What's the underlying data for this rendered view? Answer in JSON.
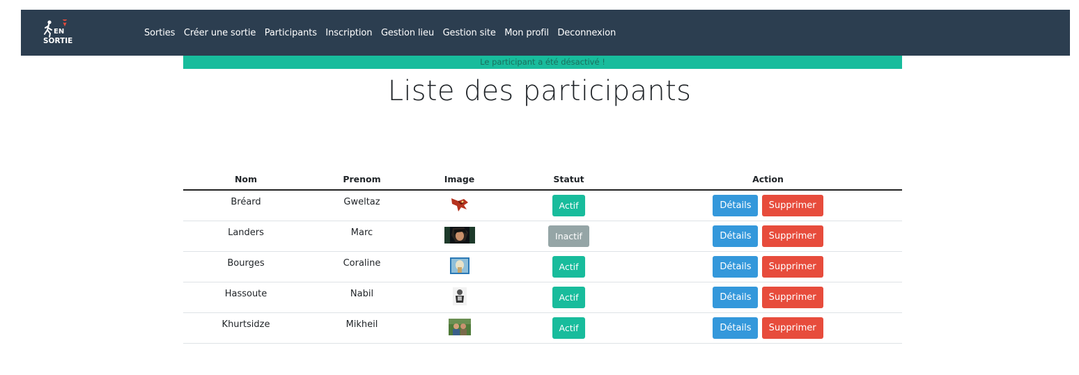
{
  "nav": {
    "logo_text_top": "EN",
    "logo_text_bottom": "SORTIE",
    "links": [
      "Sorties",
      "Créer une sortie",
      "Participants",
      "Inscription",
      "Gestion lieu",
      "Gestion site",
      "Mon profil",
      "Deconnexion"
    ]
  },
  "flash": {
    "message": "Le participant a été désactivé !"
  },
  "page": {
    "title": "Liste des participants"
  },
  "table": {
    "headers": {
      "nom": "Nom",
      "prenom": "Prenom",
      "image": "Image",
      "statut": "Statut",
      "action": "Action"
    },
    "details_label": "Détails",
    "delete_label": "Supprimer",
    "rows": [
      {
        "nom": "Bréard",
        "prenom": "Gweltaz",
        "statut": "Actif",
        "active": true
      },
      {
        "nom": "Landers",
        "prenom": "Marc",
        "statut": "Inactif",
        "active": false
      },
      {
        "nom": "Bourges",
        "prenom": "Coraline",
        "statut": "Actif",
        "active": true
      },
      {
        "nom": "Hassoute",
        "prenom": "Nabil",
        "statut": "Actif",
        "active": true
      },
      {
        "nom": "Khurtsidze",
        "prenom": "Mikheil",
        "statut": "Actif",
        "active": true
      }
    ]
  },
  "colors": {
    "navbar": "#2c3e50",
    "success": "#18bc9c",
    "secondary": "#95a5a6",
    "info": "#3498db",
    "danger": "#e74c3c"
  }
}
